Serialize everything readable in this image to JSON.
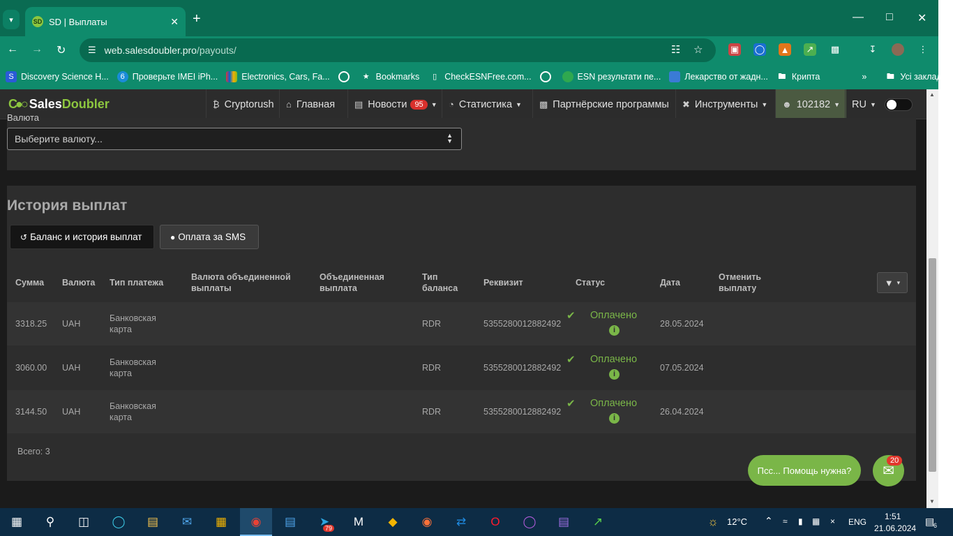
{
  "browser": {
    "tab_title": "SD | Выплаты",
    "tab_favicon": "SD",
    "url_host": "web.salesdoubler.pro",
    "url_path": "/payouts/",
    "bookmarks": [
      {
        "label": "Discovery Science H...",
        "icon": "S"
      },
      {
        "label": "Проверьте IMEI iPh...",
        "icon": "6"
      },
      {
        "label": "Electronics, Cars, Fa...",
        "icon": "e"
      },
      {
        "label": "",
        "icon": "globe"
      },
      {
        "label": "Bookmarks",
        "icon": "star"
      },
      {
        "label": "CheckESNFree.com...",
        "icon": "phone"
      },
      {
        "label": "",
        "icon": "globe"
      },
      {
        "label": "ESN результати пе...",
        "icon": "esn"
      },
      {
        "label": "Лекарство от жадн...",
        "icon": "box"
      },
      {
        "label": "Крипта",
        "icon": "folder"
      }
    ],
    "all_bookmarks": "Усі закладки"
  },
  "site": {
    "logo_sales": "Sales",
    "logo_doubler": "Doubler",
    "nav": {
      "cryptorush": "Cryptorush",
      "home": "Главная",
      "news": "Новости",
      "news_badge": "95",
      "stats": "Статистика",
      "partners": "Партнёрские программы",
      "tools": "Инструменты",
      "account": "102182",
      "lang": "RU"
    }
  },
  "currency_cut_label": "Валюта",
  "currency_placeholder": "Выберите валюту...",
  "history": {
    "title": "История выплат",
    "tab_active": "Баланс и история выплат",
    "tab_inactive": "Оплата за SMS",
    "headers": {
      "amount": "Сумма",
      "currency": "Валюта",
      "payment_type": "Тип платежа",
      "merged_currency": "Валюта объединенной выплаты",
      "merged_payout": "Объединенная выплата",
      "balance_type": "Тип баланса",
      "requisite": "Реквизит",
      "status": "Статус",
      "date": "Дата",
      "cancel": "Отменить выплату"
    },
    "rows": [
      {
        "amount": "3318.25",
        "currency": "UAH",
        "payment_type": "Банковская карта",
        "balance_type": "RDR",
        "requisite": "5355280012882492",
        "status": "Оплачено",
        "date": "28.05.2024"
      },
      {
        "amount": "3060.00",
        "currency": "UAH",
        "payment_type": "Банковская карта",
        "balance_type": "RDR",
        "requisite": "5355280012882492",
        "status": "Оплачено",
        "date": "07.05.2024"
      },
      {
        "amount": "3144.50",
        "currency": "UAH",
        "payment_type": "Банковская карта",
        "balance_type": "RDR",
        "requisite": "5355280012882492",
        "status": "Оплачено",
        "date": "26.04.2024"
      }
    ],
    "total": "Всего: 3"
  },
  "help": {
    "bubble": "Псс... Помощь нужна?",
    "count": "20"
  },
  "taskbar": {
    "weather": "12°C",
    "lang": "ENG",
    "time": "1:51",
    "date": "21.06.2024",
    "telegram_badge": "79",
    "notif_count": "6"
  },
  "colors": {
    "accent_green": "#7ab648",
    "chrome_green": "#0f8b6c",
    "badge_red": "#d9302c"
  }
}
